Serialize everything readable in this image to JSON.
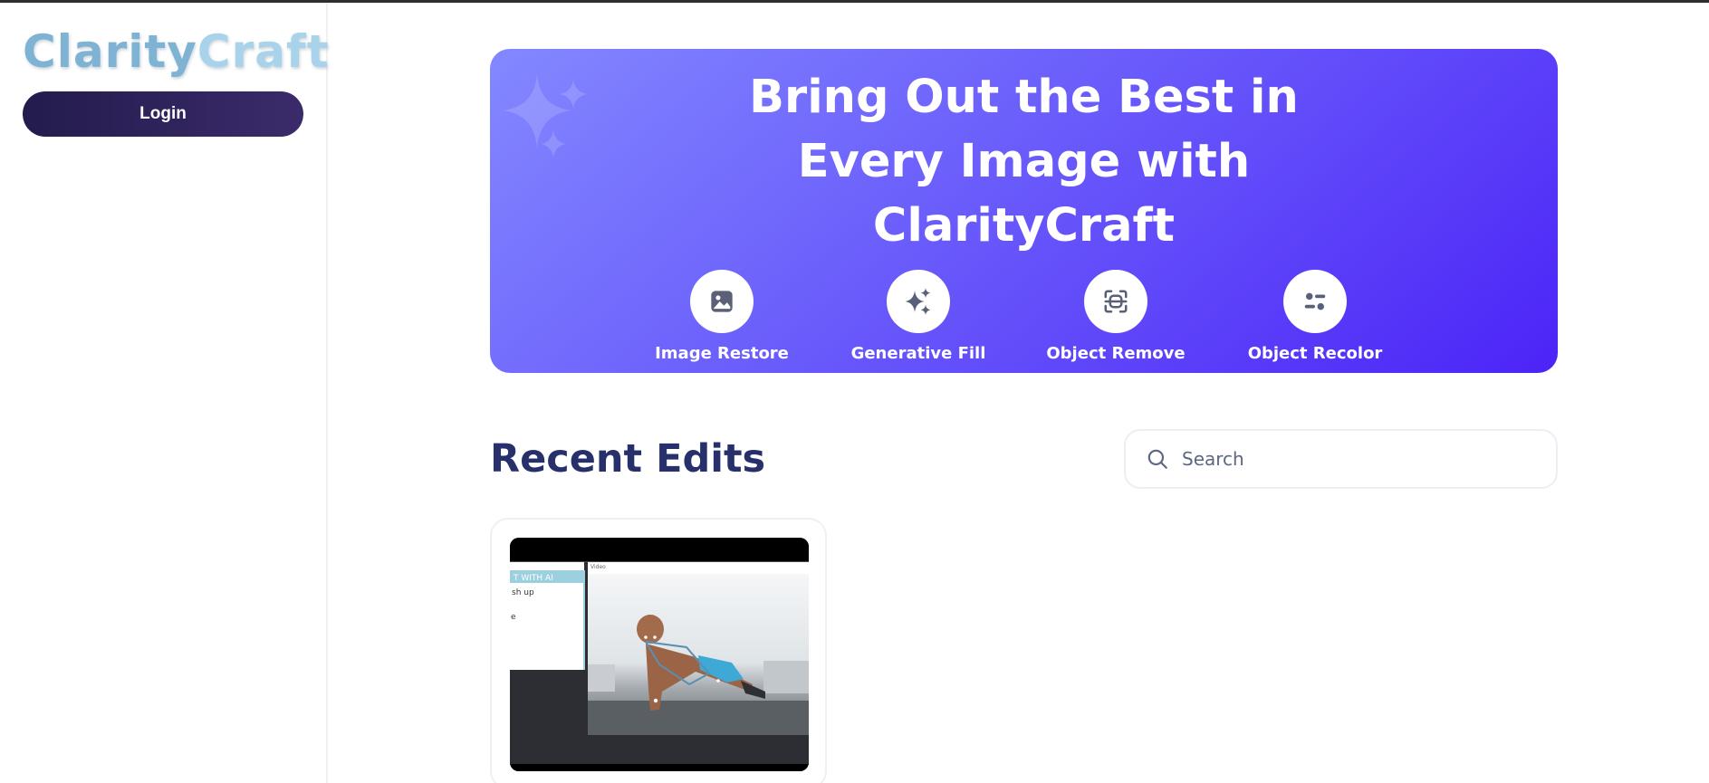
{
  "sidebar": {
    "logo_part1": "Clarity",
    "logo_part2": "Craft",
    "login_label": "Login"
  },
  "hero": {
    "title_lines": [
      "Bring Out the Best in",
      "Every Image with",
      "ClarityCraft"
    ],
    "features": [
      {
        "label": "Image Restore",
        "icon": "image-icon"
      },
      {
        "label": "Generative Fill",
        "icon": "sparkles-icon"
      },
      {
        "label": "Object Remove",
        "icon": "scan-object-icon"
      },
      {
        "label": "Object Recolor",
        "icon": "sliders-icon"
      }
    ]
  },
  "recent": {
    "title": "Recent Edits",
    "search_placeholder": "Search",
    "thumbnail_window_text": [
      "T WITH AI",
      "sh up",
      "e"
    ],
    "thumbnail_titlebar": "Video"
  },
  "colors": {
    "brand_dark": "#27306a",
    "hero_gradient_start": "#8388ff",
    "hero_gradient_end": "#4c24f7",
    "logo_light": "#a9d3ea",
    "logo_mid": "#7fb3d4"
  }
}
